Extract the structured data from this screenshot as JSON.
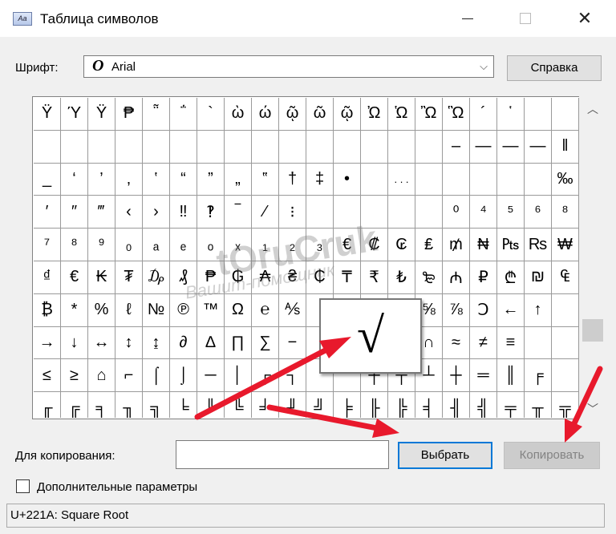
{
  "window": {
    "title": "Таблица символов"
  },
  "font": {
    "label": "Шрифт:",
    "glyph": "O",
    "value": "Arial"
  },
  "help_button": "Справка",
  "grid": {
    "cells": [
      "Ÿ",
      "Ύ",
      "Ϋ",
      "₱",
      "῁",
      "΅",
      "`",
      "ὼ",
      "ώ",
      "ῷ",
      "ῶ",
      "ῷ",
      "Ὠ",
      "Ὡ",
      "Ὢ",
      "Ὣ",
      "´",
      "῾",
      "",
      "",
      "",
      "",
      "",
      "",
      "",
      "",
      "",
      "",
      "",
      "",
      "",
      "",
      "",
      "",
      "",
      "–",
      "—",
      "—",
      "—",
      "‖",
      "_",
      "‘",
      "’",
      "‚",
      "‛",
      "“",
      "”",
      "„",
      "‟",
      "†",
      "‡",
      "•",
      "",
      ". . .",
      "",
      "",
      "",
      "",
      "",
      "‰",
      "′",
      "″",
      "‴",
      "‹",
      "›",
      "‼",
      "‽",
      "‾",
      "⁄",
      "⁝",
      "",
      "",
      "",
      "",
      "",
      "⁰",
      "⁴",
      "⁵",
      "⁶",
      "⁸",
      "⁷",
      "⁸",
      "⁹",
      "₀",
      "ₐ",
      "ₑ",
      "ₒ",
      "ₓ",
      "₁",
      "₂",
      "₃",
      "€",
      "₡",
      "₢",
      "₤",
      "₥",
      "₦",
      "₧",
      "₨",
      "₩",
      "₫",
      "€",
      "₭",
      "₮",
      "₯",
      "₰",
      "₱",
      "₲",
      "₳",
      "₴",
      "₵",
      "₸",
      "₹",
      "₺",
      "₻",
      "₼",
      "₽",
      "₾",
      "₪",
      "₠",
      "₿",
      "*",
      "%",
      "ℓ",
      "№",
      "℗",
      "™",
      "Ω",
      "℮",
      "⅍",
      "",
      "⅓",
      "⅔",
      "⅜",
      "⅝",
      "⅞",
      "Ↄ",
      "←",
      "↑",
      "",
      "→",
      "↓",
      "↔",
      "↕",
      "↨",
      "∂",
      "∆",
      "∏",
      "∑",
      "−",
      "",
      "",
      "",
      "",
      "∩",
      "≈",
      "≠",
      "≡",
      "",
      "",
      "≤",
      "≥",
      "⌂",
      "⌐",
      "⌠",
      "⌡",
      "─",
      "│",
      "┌",
      "┐",
      "",
      "",
      "┼",
      "┬",
      "┴",
      "┼",
      "═",
      "║",
      "╒",
      "",
      "╓",
      "╔",
      "╕",
      "╖",
      "╗",
      "╘",
      "╙",
      "╚",
      "╛",
      "╜",
      "╝",
      "╞",
      "╟",
      "╠",
      "╡",
      "╢",
      "╣",
      "╤",
      "╥",
      "╦"
    ]
  },
  "zoom_symbol": "√",
  "watermark": {
    "text": "tOruCruk",
    "sub": "Вашит-помощник"
  },
  "copy": {
    "label": "Для копирования:",
    "value": ""
  },
  "select_button": "Выбрать",
  "copy_button": "Копировать",
  "advanced": {
    "label": "Дополнительные параметры",
    "checked": false
  },
  "status": "U+221A: Square Root",
  "annotation_color": "#e8192c"
}
